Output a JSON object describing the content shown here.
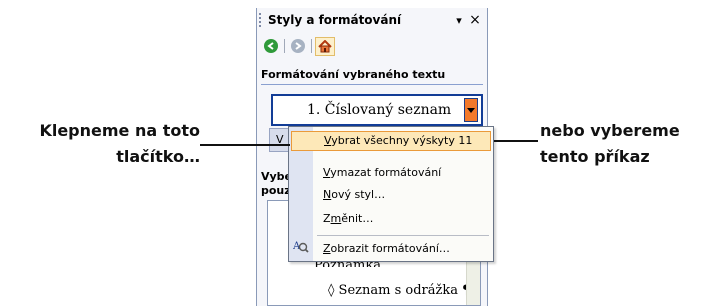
{
  "pane": {
    "title": "Styly a formátování",
    "dropdown_glyph": "▾",
    "close_glyph": "×",
    "section_label": "Formátování vybraného textu",
    "selected_style": "1.  Číslovaný seznam",
    "select_all_button_partial": "V",
    "apply_label_line1": "Vybe",
    "apply_label_line2": "pouz",
    "list_partial_item": "Poznámka",
    "list_partial_pilcrow": "¶",
    "list_item": "◊  Seznam s odrážka ¶"
  },
  "menu": {
    "items": [
      {
        "acc": "V",
        "rest": "ybrat všechny výskyty 11",
        "hover": true
      },
      {
        "acc": "V",
        "rest": "ymazat formátování",
        "hover": false
      },
      {
        "acc": "N",
        "rest": "ový styl…",
        "hover": false
      },
      {
        "pre": "Z",
        "acc": "m",
        "rest": "ěnit…",
        "hover": false
      },
      {
        "acc": "Z",
        "rest": "obrazit formátování…",
        "hover": false
      }
    ]
  },
  "callouts": {
    "left_line1": "Klepneme na toto",
    "left_line2": "tlačítko…",
    "right_line1": "nebo vybereme",
    "right_line2": "tento příkaz"
  },
  "icons": {
    "back": "back-arrow-icon",
    "forward": "forward-arrow-icon",
    "home": "home-icon",
    "reveal": "reveal-formatting-icon",
    "dropdown_arrow": "chevron-down-icon"
  },
  "colors": {
    "accent_blue": "#123c96",
    "dropdown_orange": "#f3792a",
    "menu_hover": "#fde8b8"
  }
}
